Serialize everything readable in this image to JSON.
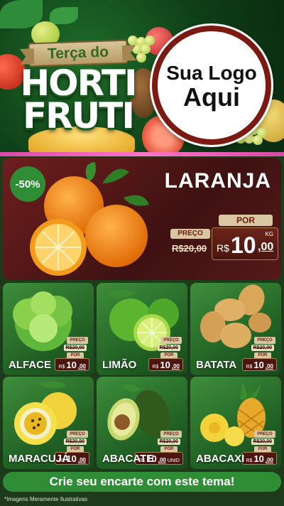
{
  "header": {
    "banner": "Terça do",
    "title_line1": "HORTI",
    "title_line2": "FRUTI",
    "logo_line1": "Sua Logo",
    "logo_line2": "Aqui"
  },
  "main_offer": {
    "discount": "-50%",
    "name": "LARANJA",
    "preco_label": "PREÇO",
    "old_price": "R$20,00",
    "por_label": "POR",
    "currency": "R$",
    "price_int": "10",
    "price_dec": ",00",
    "unit": "KG"
  },
  "products": [
    {
      "name": "ALFACE",
      "preco_label": "PREÇO",
      "old_price": "R$20,00",
      "por_label": "POR",
      "currency": "R$",
      "price_int": "10",
      "price_dec": ",00"
    },
    {
      "name": "LIMÃO",
      "preco_label": "PREÇO",
      "old_price": "R$20,00",
      "por_label": "POR",
      "currency": "R$",
      "price_int": "10",
      "price_dec": ",00"
    },
    {
      "name": "BATATA",
      "preco_label": "PREÇO",
      "old_price": "R$20,00",
      "por_label": "POR",
      "currency": "R$",
      "price_int": "10",
      "price_dec": ",00"
    },
    {
      "name": "MARACUJÁ",
      "preco_label": "PREÇO",
      "old_price": "R$20,00",
      "por_label": "POR",
      "currency": "R$",
      "price_int": "10",
      "price_dec": ",00"
    },
    {
      "name": "ABACATE",
      "preco_label": "PREÇO",
      "old_price": "R$20,00",
      "por_label": "POR",
      "currency": "R$",
      "price_int": "10",
      "price_dec": ",00",
      "unit": "UNID"
    },
    {
      "name": "ABACAXI",
      "preco_label": "PREÇO",
      "old_price": "R$20,00",
      "por_label": "POR",
      "currency": "R$",
      "price_int": "10",
      "price_dec": ",00"
    }
  ],
  "cta": "Crie seu encarte com este tema!",
  "disclaimer": "*Imagens Meramente Ilustrativas",
  "colors": {
    "green_dark": "#1d3a1a",
    "green_accent": "#2f8d35",
    "maroon": "#6f1e1e",
    "pink_stripe": "#d84aa7",
    "tag_beige": "#d9c7a2"
  }
}
